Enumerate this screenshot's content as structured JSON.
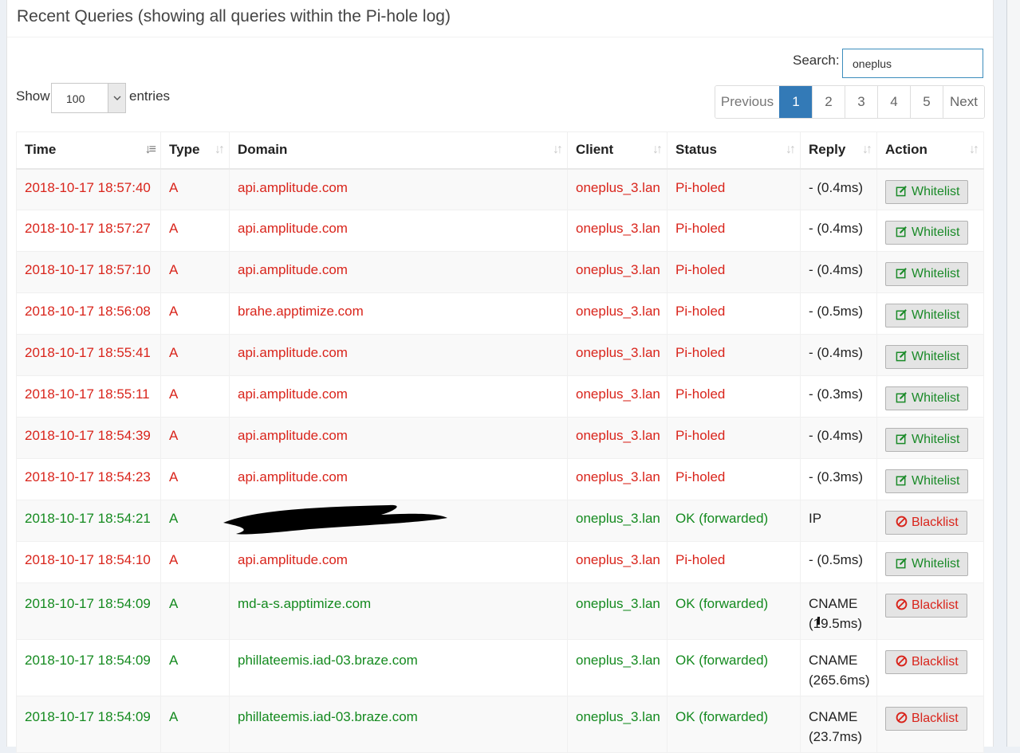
{
  "panel": {
    "title": "Recent Queries (showing all queries within the Pi-hole log)"
  },
  "search": {
    "label": "Search:",
    "value": "oneplus"
  },
  "length": {
    "show_label": "Show",
    "value": "100",
    "entries_label": "entries"
  },
  "pagination": {
    "previous": "Previous",
    "pages": [
      "1",
      "2",
      "3",
      "4",
      "5"
    ],
    "active_page": "1",
    "next": "Next"
  },
  "columns": [
    "Time",
    "Type",
    "Domain",
    "Client",
    "Status",
    "Reply",
    "Action"
  ],
  "rows": [
    {
      "time": "2018-10-17 18:57:40",
      "type": "A",
      "domain": "api.amplitude.com",
      "client": "oneplus_3.lan",
      "status": "Pi-holed",
      "reply": "- (0.4ms)",
      "action": "Whitelist"
    },
    {
      "time": "2018-10-17 18:57:27",
      "type": "A",
      "domain": "api.amplitude.com",
      "client": "oneplus_3.lan",
      "status": "Pi-holed",
      "reply": "- (0.4ms)",
      "action": "Whitelist"
    },
    {
      "time": "2018-10-17 18:57:10",
      "type": "A",
      "domain": "api.amplitude.com",
      "client": "oneplus_3.lan",
      "status": "Pi-holed",
      "reply": "- (0.4ms)",
      "action": "Whitelist"
    },
    {
      "time": "2018-10-17 18:56:08",
      "type": "A",
      "domain": "brahe.apptimize.com",
      "client": "oneplus_3.lan",
      "status": "Pi-holed",
      "reply": "- (0.5ms)",
      "action": "Whitelist"
    },
    {
      "time": "2018-10-17 18:55:41",
      "type": "A",
      "domain": "api.amplitude.com",
      "client": "oneplus_3.lan",
      "status": "Pi-holed",
      "reply": "- (0.4ms)",
      "action": "Whitelist"
    },
    {
      "time": "2018-10-17 18:55:11",
      "type": "A",
      "domain": "api.amplitude.com",
      "client": "oneplus_3.lan",
      "status": "Pi-holed",
      "reply": "- (0.3ms)",
      "action": "Whitelist"
    },
    {
      "time": "2018-10-17 18:54:39",
      "type": "A",
      "domain": "api.amplitude.com",
      "client": "oneplus_3.lan",
      "status": "Pi-holed",
      "reply": "- (0.4ms)",
      "action": "Whitelist"
    },
    {
      "time": "2018-10-17 18:54:23",
      "type": "A",
      "domain": "api.amplitude.com",
      "client": "oneplus_3.lan",
      "status": "Pi-holed",
      "reply": "- (0.3ms)",
      "action": "Whitelist"
    },
    {
      "time": "2018-10-17 18:54:21",
      "type": "A",
      "domain": "",
      "client": "oneplus_3.lan",
      "status": "OK (forwarded)",
      "reply": "IP",
      "action": "Blacklist"
    },
    {
      "time": "2018-10-17 18:54:10",
      "type": "A",
      "domain": "api.amplitude.com",
      "client": "oneplus_3.lan",
      "status": "Pi-holed",
      "reply": "- (0.5ms)",
      "action": "Whitelist"
    },
    {
      "time": "2018-10-17 18:54:09",
      "type": "A",
      "domain": "md-a-s.apptimize.com",
      "client": "oneplus_3.lan",
      "status": "OK (forwarded)",
      "reply": "CNAME (19.5ms)",
      "action": "Blacklist"
    },
    {
      "time": "2018-10-17 18:54:09",
      "type": "A",
      "domain": "phillateemis.iad-03.braze.com",
      "client": "oneplus_3.lan",
      "status": "OK (forwarded)",
      "reply": "CNAME (265.6ms)",
      "action": "Blacklist"
    },
    {
      "time": "2018-10-17 18:54:09",
      "type": "A",
      "domain": "phillateemis.iad-03.braze.com",
      "client": "oneplus_3.lan",
      "status": "OK (forwarded)",
      "reply": "CNAME (23.7ms)",
      "action": "Blacklist"
    }
  ],
  "colors": {
    "blocked": "#d9241b",
    "allowed": "#148a1f",
    "accent": "#337ab7"
  },
  "icons": {
    "whitelist": "pencil-square-icon",
    "blacklist": "ban-icon"
  }
}
